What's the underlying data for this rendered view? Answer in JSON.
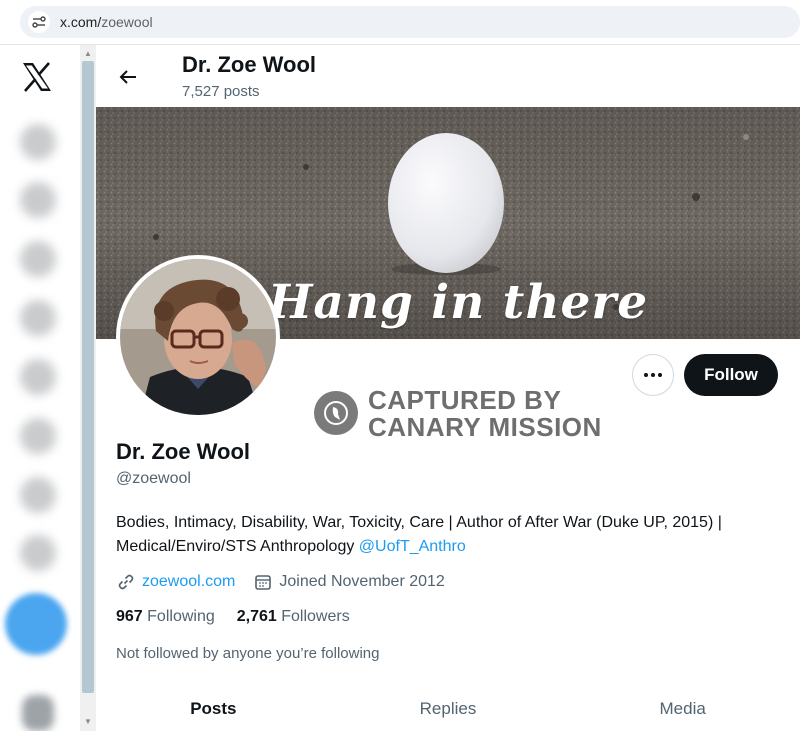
{
  "browser": {
    "url_domain": "x.com/",
    "url_path": "zoewool"
  },
  "nav": {
    "logo": "x-logo",
    "items": [
      "home-icon",
      "search-icon",
      "notifications-icon",
      "messages-icon",
      "grok-icon",
      "lists-icon",
      "communities-icon",
      "profile-icon",
      "more-icon"
    ],
    "compose_color": "#4ba6ef"
  },
  "header": {
    "name": "Dr. Zoe Wool",
    "posts_count": "7,527 posts"
  },
  "banner": {
    "text": "Hang in there"
  },
  "watermark": {
    "line1": "CAPTURED BY",
    "line2": "CANARY MISSION"
  },
  "actions": {
    "follow_label": "Follow",
    "more_icon": "more-dots-icon"
  },
  "profile": {
    "name": "Dr. Zoe Wool",
    "handle": "@zoewool",
    "bio_text": "Bodies, Intimacy, Disability, War, Toxicity, Care | Author of After War (Duke UP, 2015) | Medical/Enviro/STS Anthropology ",
    "bio_mention": "@UofT_Anthro",
    "website": "zoewool.com",
    "joined": "Joined November 2012",
    "following_count": "967",
    "following_label": "Following",
    "followers_count": "2,761",
    "followers_label": "Followers",
    "followed_by": "Not followed by anyone you’re following"
  },
  "tabs": [
    "Posts",
    "Replies",
    "Media"
  ],
  "colors": {
    "accent": "#1d9bf0",
    "follow_button": "#0f1419",
    "muted_text": "#536471"
  }
}
